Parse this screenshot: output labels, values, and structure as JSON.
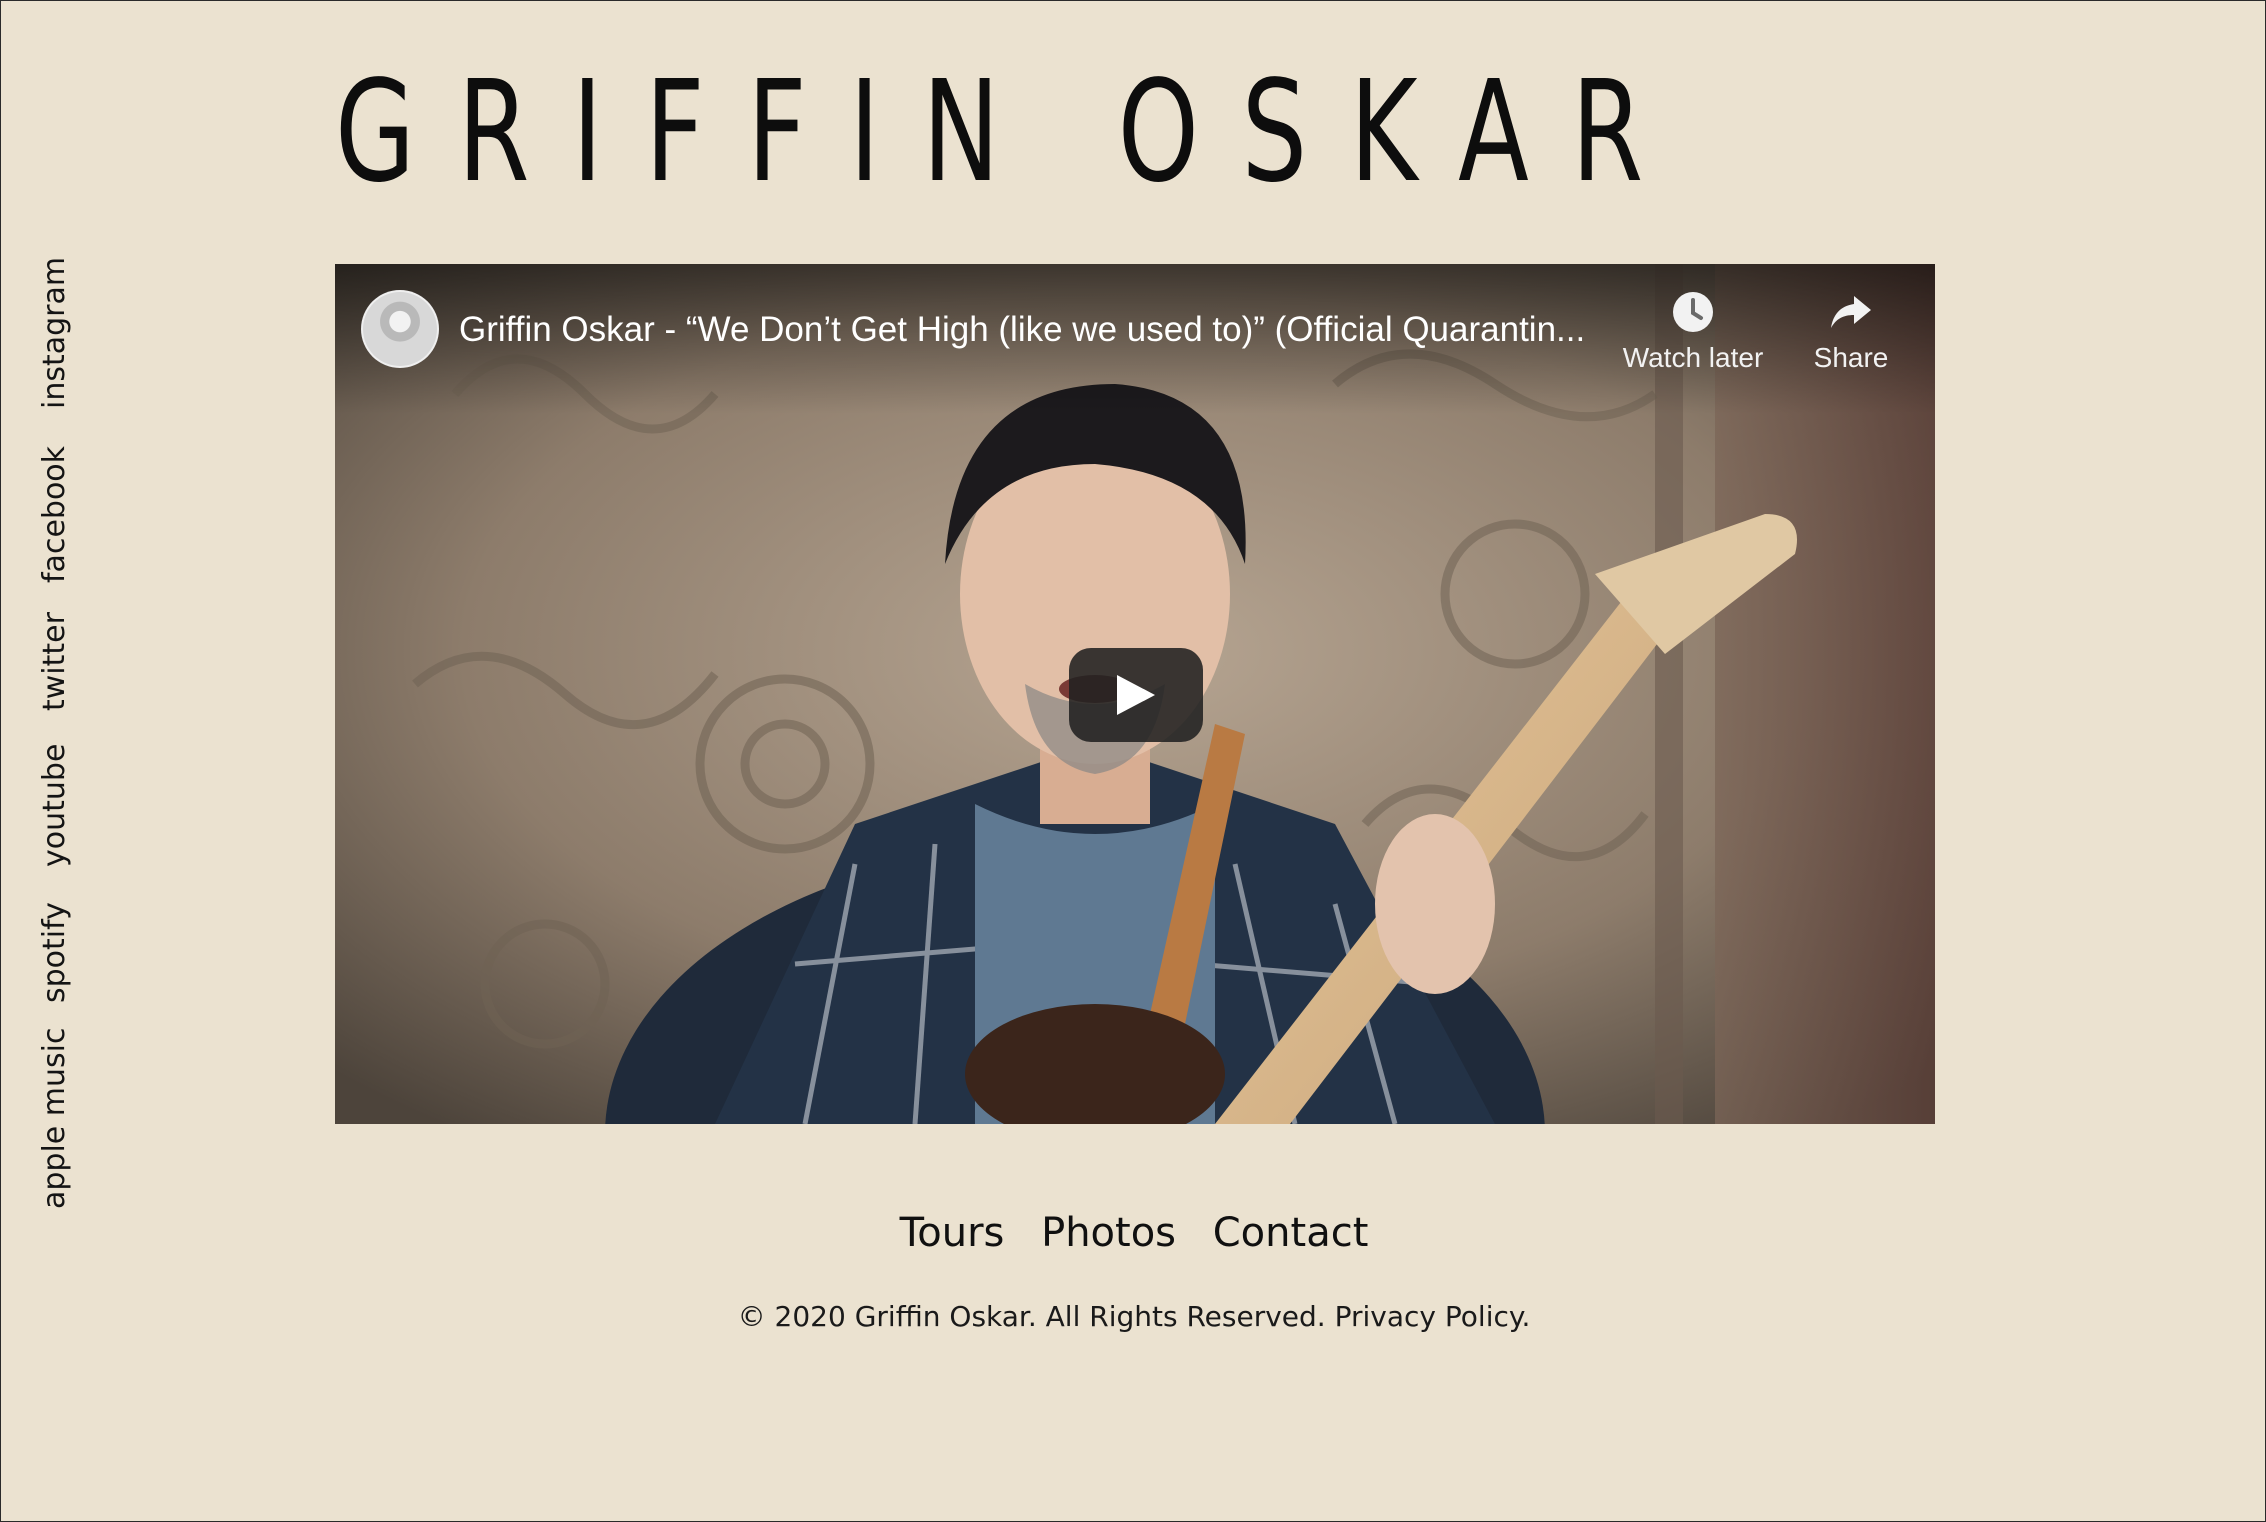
{
  "site": {
    "title": "GRIFFIN OSKAR"
  },
  "social_links": [
    {
      "label": "instagram"
    },
    {
      "label": "facebook"
    },
    {
      "label": "twitter"
    },
    {
      "label": "youtube"
    },
    {
      "label": "spotify"
    },
    {
      "label": "apple music"
    }
  ],
  "video": {
    "title": "Griffin Oskar - “We Don’t Get High (like we used to)” (Official Quarantin...",
    "watch_later_label": "Watch later",
    "share_label": "Share",
    "icons": {
      "avatar": "channel-avatar",
      "watch_later": "clock-icon",
      "share": "share-arrow-icon",
      "play": "play-icon"
    }
  },
  "footer": {
    "nav": [
      {
        "label": "Tours"
      },
      {
        "label": "Photos"
      },
      {
        "label": "Contact"
      }
    ],
    "copyright": "© 2020 Griffin Oskar. All Rights Reserved.",
    "privacy_label": "Privacy Policy."
  },
  "colors": {
    "background": "#ebe2d0",
    "text": "#111111",
    "play_button": "#212121"
  }
}
